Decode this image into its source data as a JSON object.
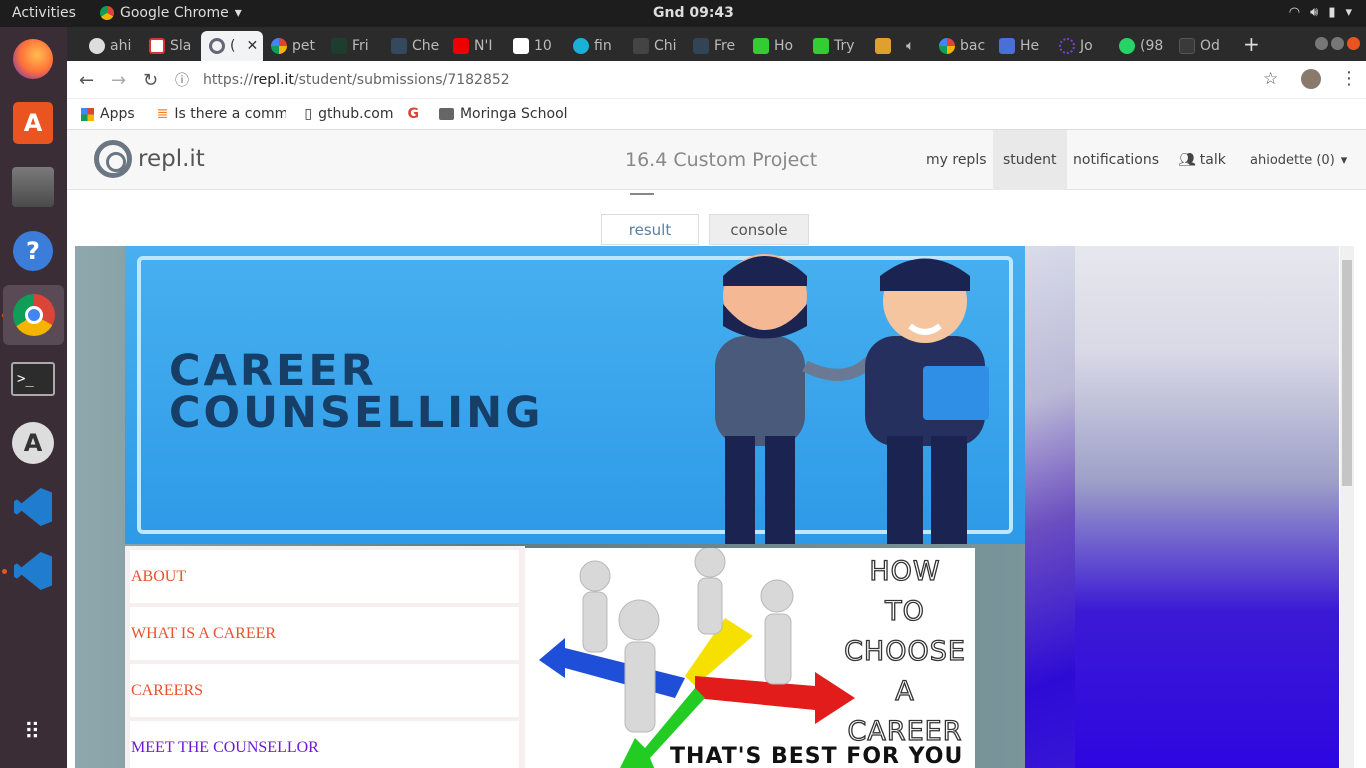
{
  "desktop": {
    "activities": "Activities",
    "app_name": "Google Chrome",
    "clock": "Gnd 09:43"
  },
  "browser": {
    "tabs": [
      {
        "label": "ahi"
      },
      {
        "label": "Sla"
      },
      {
        "label": "("
      },
      {
        "label": "pet"
      },
      {
        "label": "Fri"
      },
      {
        "label": "Che"
      },
      {
        "label": "N'I"
      },
      {
        "label": "10"
      },
      {
        "label": "fin"
      },
      {
        "label": "Chi"
      },
      {
        "label": "Fre"
      },
      {
        "label": "Ho"
      },
      {
        "label": "Try"
      },
      {
        "label": ""
      },
      {
        "label": "bac"
      },
      {
        "label": "He"
      },
      {
        "label": "Jo"
      },
      {
        "label": "(98"
      },
      {
        "label": "Od"
      }
    ],
    "url_prefix": "https://",
    "url_domain": "repl.it",
    "url_path": "/student/submissions/7182852",
    "bookmarks": [
      "Apps",
      "Is there a comma",
      "gthub.com",
      "",
      "Moringa School"
    ]
  },
  "replit": {
    "logo_text": "repl.it",
    "project_title": "16.4 Custom Project",
    "links": {
      "my_repls": "my repls",
      "student": "student",
      "notifications": "notifications",
      "talk": "talk",
      "user": "ahiodette (0)"
    },
    "view_tabs": {
      "result": "result",
      "console": "console"
    }
  },
  "site": {
    "hero_title": "CAREER\nCOUNSELLING",
    "nav": [
      "ABOUT",
      "WHAT IS A CAREER",
      "CAREERS",
      "MEET THE COUNSELLOR"
    ],
    "howto_text": "HOW TO CHOOSE A CAREER",
    "howto_words": [
      "HOW",
      "TO",
      "CHOOSE",
      "A",
      "CAREER"
    ],
    "howto_bottom": "THAT'S BEST FOR YOU"
  },
  "colors": {
    "ubuntu_orange": "#e95420",
    "link_color": "#e8512d",
    "visited_link": "#6a1ad6",
    "hero_blue": "#3aa6ee",
    "hero_text": "#163e66"
  }
}
